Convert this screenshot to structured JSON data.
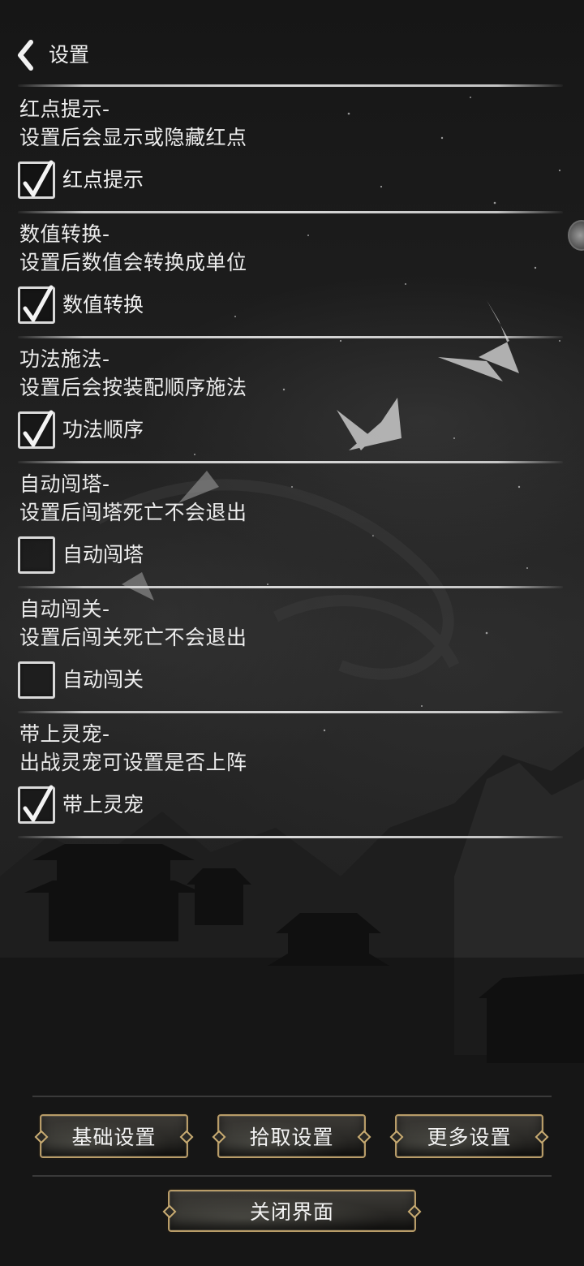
{
  "header": {
    "title": "设置"
  },
  "sections": [
    {
      "title": "红点提示-",
      "description": "设置后会显示或隐藏红点",
      "checkbox_label": "红点提示",
      "checked": true
    },
    {
      "title": "数值转换-",
      "description": "设置后数值会转换成单位",
      "checkbox_label": "数值转换",
      "checked": true
    },
    {
      "title": "功法施法-",
      "description": "设置后会按装配顺序施法",
      "checkbox_label": "功法顺序",
      "checked": true
    },
    {
      "title": "自动闯塔-",
      "description": "设置后闯塔死亡不会退出",
      "checkbox_label": "自动闯塔",
      "checked": false
    },
    {
      "title": "自动闯关-",
      "description": "设置后闯关死亡不会退出",
      "checkbox_label": "自动闯关",
      "checked": false
    },
    {
      "title": "带上灵宠-",
      "description": "出战灵宠可设置是否上阵",
      "checkbox_label": "带上灵宠",
      "checked": true
    }
  ],
  "buttons": {
    "basic": "基础设置",
    "pickup": "拾取设置",
    "more": "更多设置",
    "close": "关闭界面"
  },
  "colors": {
    "text": "#ececec",
    "divider": "#e6e6e6",
    "button_border": "#b89c68"
  },
  "icons": {
    "back": "chevron-left-icon",
    "check": "checkmark-icon"
  }
}
